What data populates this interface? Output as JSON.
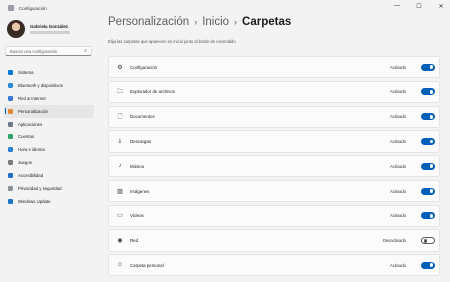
{
  "window": {
    "title": "Configuración",
    "controls": [
      "—",
      "☐",
      "✕"
    ]
  },
  "profile": {
    "name": "Gabriela González"
  },
  "search": {
    "placeholder": "Buscar una configuración",
    "icon": "search-icon"
  },
  "sidebar": {
    "items": [
      {
        "label": "Sistema",
        "color": "#0078d4",
        "icon": "monitor-icon"
      },
      {
        "label": "Bluetooth y dispositivos",
        "color": "#2e8bd8",
        "icon": "bluetooth-icon"
      },
      {
        "label": "Red & Internet",
        "color": "#3a7bd5",
        "icon": "wifi-icon"
      },
      {
        "label": "Personalización",
        "color": "#e0892e",
        "icon": "brush-icon",
        "active": true
      },
      {
        "label": "Aplicaciones",
        "color": "#6c7a89",
        "icon": "apps-icon"
      },
      {
        "label": "Cuentas",
        "color": "#2fa36b",
        "icon": "person-icon"
      },
      {
        "label": "Hora e idioma",
        "color": "#2d7fd3",
        "icon": "clock-icon"
      },
      {
        "label": "Juegos",
        "color": "#7a7a7a",
        "icon": "gamepad-icon"
      },
      {
        "label": "Accesibilidad",
        "color": "#1f6fc5",
        "icon": "accessibility-icon"
      },
      {
        "label": "Privacidad y seguridad",
        "color": "#8a8f96",
        "icon": "shield-icon"
      },
      {
        "label": "Windows Update",
        "color": "#1a73c7",
        "icon": "update-icon"
      }
    ]
  },
  "breadcrumb": {
    "level1": "Personalización",
    "level2": "Inicio",
    "current": "Carpetas",
    "separator": "›"
  },
  "description": "Elija las carpetas que aparecen en inicio junto al botón de encendido",
  "folders": [
    {
      "label": "Configuración",
      "icon": "⚙",
      "icon_name": "gear-icon",
      "state": "Activado",
      "on": true
    },
    {
      "label": "Explorador de archivos",
      "icon": "🗀",
      "icon_name": "folder-icon",
      "state": "Activado",
      "on": true
    },
    {
      "label": "Documentos",
      "icon": "🗋",
      "icon_name": "document-icon",
      "state": "Activado",
      "on": true
    },
    {
      "label": "Descargas",
      "icon": "⤓",
      "icon_name": "download-icon",
      "state": "Activado",
      "on": true
    },
    {
      "label": "Música",
      "icon": "♪",
      "icon_name": "music-icon",
      "state": "Activado",
      "on": true
    },
    {
      "label": "Imágenes",
      "icon": "▨",
      "icon_name": "image-icon",
      "state": "Activado",
      "on": true
    },
    {
      "label": "Vídeos",
      "icon": "▭",
      "icon_name": "video-icon",
      "state": "Activado",
      "on": true
    },
    {
      "label": "Red",
      "icon": "◉",
      "icon_name": "network-icon",
      "state": "Desactivado",
      "on": false
    },
    {
      "label": "Carpeta personal",
      "icon": "☺",
      "icon_name": "user-folder-icon",
      "state": "Activado",
      "on": true
    }
  ]
}
